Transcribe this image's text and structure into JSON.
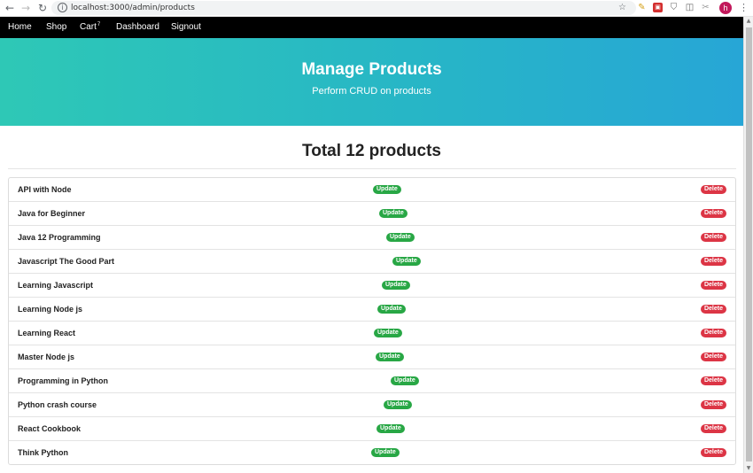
{
  "browser": {
    "url": "localhost:3000/admin/products",
    "icons": {
      "back": "←",
      "forward": "→",
      "reload": "↻",
      "info": "i",
      "star": "☆",
      "ext1": "✎",
      "ext2": "▣",
      "ext3": "⛉",
      "ext4": "◫",
      "ext5": "✂",
      "menu": "⋮",
      "scroll_up": "▲",
      "scroll_down": "▼"
    },
    "avatar_letter": "h"
  },
  "nav": {
    "home": "Home",
    "shop": "Shop",
    "cart": "Cart",
    "cart_count": "7",
    "dashboard": "Dashboard",
    "signout": "Signout"
  },
  "hero": {
    "title": "Manage Products",
    "subtitle": "Perform CRUD on products"
  },
  "total_label": "Total 12 products",
  "actions": {
    "update": "Update",
    "delete": "Delete"
  },
  "products": [
    "API with Node",
    "Java for Beginner",
    "Java 12 Programming",
    "Javascript The Good Part",
    "Learning Javascript",
    "Learning Node js",
    "Learning React",
    "Master Node js",
    "Programming in Python",
    "Python crash course",
    "React Cookbook",
    "Think Python"
  ],
  "colors": {
    "navbar": "#000000",
    "hero_start": "#2ec8b6",
    "hero_end": "#27a6d6",
    "update_badge": "#28a745",
    "delete_badge": "#dc3545"
  }
}
